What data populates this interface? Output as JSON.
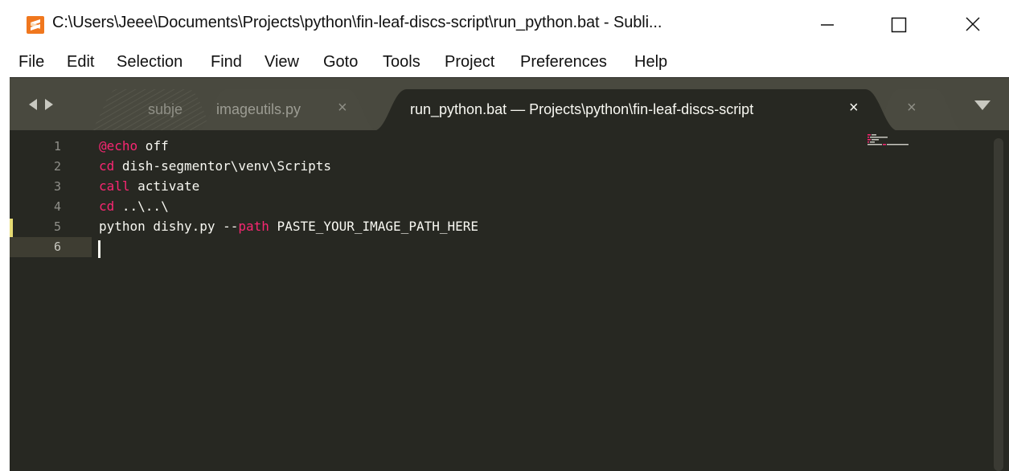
{
  "window": {
    "title": "C:\\Users\\Jeee\\Documents\\Projects\\python\\fin-leaf-discs-script\\run_python.bat - Subli...",
    "icon": "sublime-text-icon",
    "buttons": [
      "minimize-icon",
      "maximize-icon",
      "close-icon"
    ]
  },
  "menu": {
    "items": [
      "File",
      "Edit",
      "Selection",
      "Find",
      "View",
      "Goto",
      "Tools",
      "Project",
      "Preferences",
      "Help"
    ]
  },
  "tabs": {
    "items": [
      {
        "label": "subje",
        "close": "",
        "active": false
      },
      {
        "label": "imageutils.py",
        "close": "×",
        "active": false
      },
      {
        "label": "run_python.bat — Projects\\python\\fin-leaf-discs-script",
        "close": "×",
        "active": true
      },
      {
        "label": "",
        "close": "×",
        "active": false
      }
    ]
  },
  "editor": {
    "line_numbers": [
      "1",
      "2",
      "3",
      "4",
      "5",
      "6"
    ],
    "lines": [
      [
        {
          "t": "@echo",
          "kw": true
        },
        {
          "t": " off",
          "kw": false
        }
      ],
      [
        {
          "t": "cd",
          "kw": true
        },
        {
          "t": " dish-segmentor\\venv\\Scripts",
          "kw": false
        }
      ],
      [
        {
          "t": "call",
          "kw": true
        },
        {
          "t": " activate",
          "kw": false
        }
      ],
      [
        {
          "t": "cd",
          "kw": true
        },
        {
          "t": " ..\\..\\",
          "kw": false
        }
      ],
      [
        {
          "t": "python dishy.py --",
          "kw": false
        },
        {
          "t": "path",
          "kw": true
        },
        {
          "t": " PASTE_YOUR_IMAGE_PATH_HERE",
          "kw": false
        }
      ],
      []
    ],
    "current_line": 6,
    "modified_line": 5
  },
  "colors": {
    "background": "#272822",
    "tabbar": "#49493f",
    "keyword": "#f92672",
    "text": "#f8f8f2",
    "line_number": "#90908a",
    "modified_marker": "#e6db74",
    "app_icon": "#f0771e"
  }
}
